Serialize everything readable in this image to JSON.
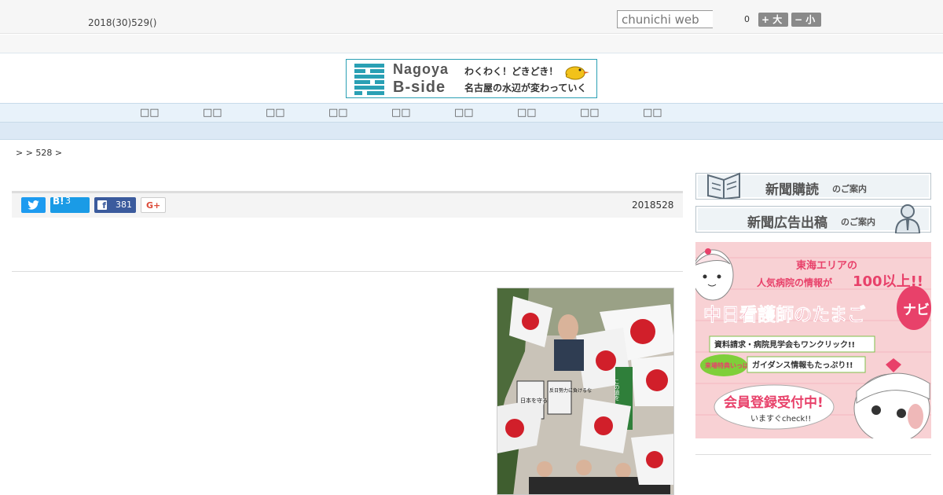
{
  "header": {
    "date": "2018(30)529()",
    "search_placeholder": "chunichi web",
    "font_count": "0",
    "font_large": "+ 大",
    "font_small": "− 小"
  },
  "banner": {
    "title_line1": "Nagoya",
    "title_line2": "B-side",
    "sub_line1": "わくわく！どきどき！",
    "sub_line2": "名古屋の水辺が変わっていく"
  },
  "nav": {
    "items": [
      "□□",
      "□□",
      "□□",
      "□□",
      "□□",
      "□□",
      "□□",
      "□□",
      "□□"
    ]
  },
  "breadcrumb": ">  > 528 >",
  "share": {
    "hatena_label": "B!",
    "hatena_count": "3",
    "facebook_count": "381",
    "gplus_label": "G+"
  },
  "post_date": "2018528",
  "sidebar": {
    "subscribe_main": "新聞購読",
    "subscribe_tail": "のご案内",
    "advertise_main": "新聞広告出稿",
    "advertise_tail": "のご案内"
  },
  "ad": {
    "line1": "東海エリアの",
    "line2a": "人気病院の情報が",
    "line2b": "100以上!!",
    "title": "中日看護師のたまご",
    "badge": "ナビ",
    "feature1": "資料請求・病院見学会もワンクリック!!",
    "tag": "来場特典いっぱい",
    "feature2": "ガイダンス情報もたっぷり!!",
    "cta": "会員登録受付中!",
    "cta_sub": "いますぐcheck!!"
  },
  "photo_signs": {
    "sign1": "日本を守る",
    "sign2": "反日勢力に負けるな",
    "sign3": "この道を"
  },
  "colors": {
    "twitter": "#1d9bf0",
    "hatena": "#1a9be6",
    "facebook": "#3b5b9d",
    "banner_accent": "#2aa0b4",
    "ad_pink": "#f8d1d4",
    "ad_title": "#e8416a"
  }
}
